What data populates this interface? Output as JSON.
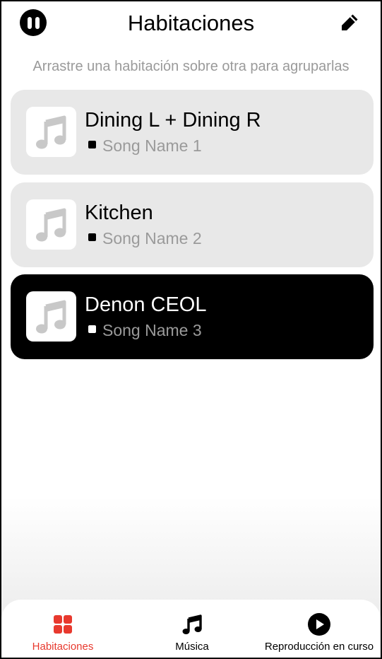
{
  "header": {
    "title": "Habitaciones",
    "left_icon": "pause-circle-icon",
    "right_icon": "pencil-icon"
  },
  "hint": "Arrastre una habitación sobre otra para agruparlas",
  "rooms": [
    {
      "name": "Dining L + Dining R",
      "song": "Song Name 1",
      "active": false
    },
    {
      "name": "Kitchen",
      "song": "Song Name 2",
      "active": false
    },
    {
      "name": "Denon CEOL",
      "song": "Song Name 3",
      "active": true
    }
  ],
  "tabs": [
    {
      "label": "Habitaciones",
      "icon": "rooms-grid-icon",
      "active": true
    },
    {
      "label": "Música",
      "icon": "music-note-icon",
      "active": false
    },
    {
      "label": "Reproducción en curso",
      "icon": "play-circle-icon",
      "active": false
    }
  ],
  "colors": {
    "accent": "#e8392e",
    "card": "#e8e8e8",
    "card_active": "#000000",
    "secondary_text": "#9a9a9a"
  }
}
